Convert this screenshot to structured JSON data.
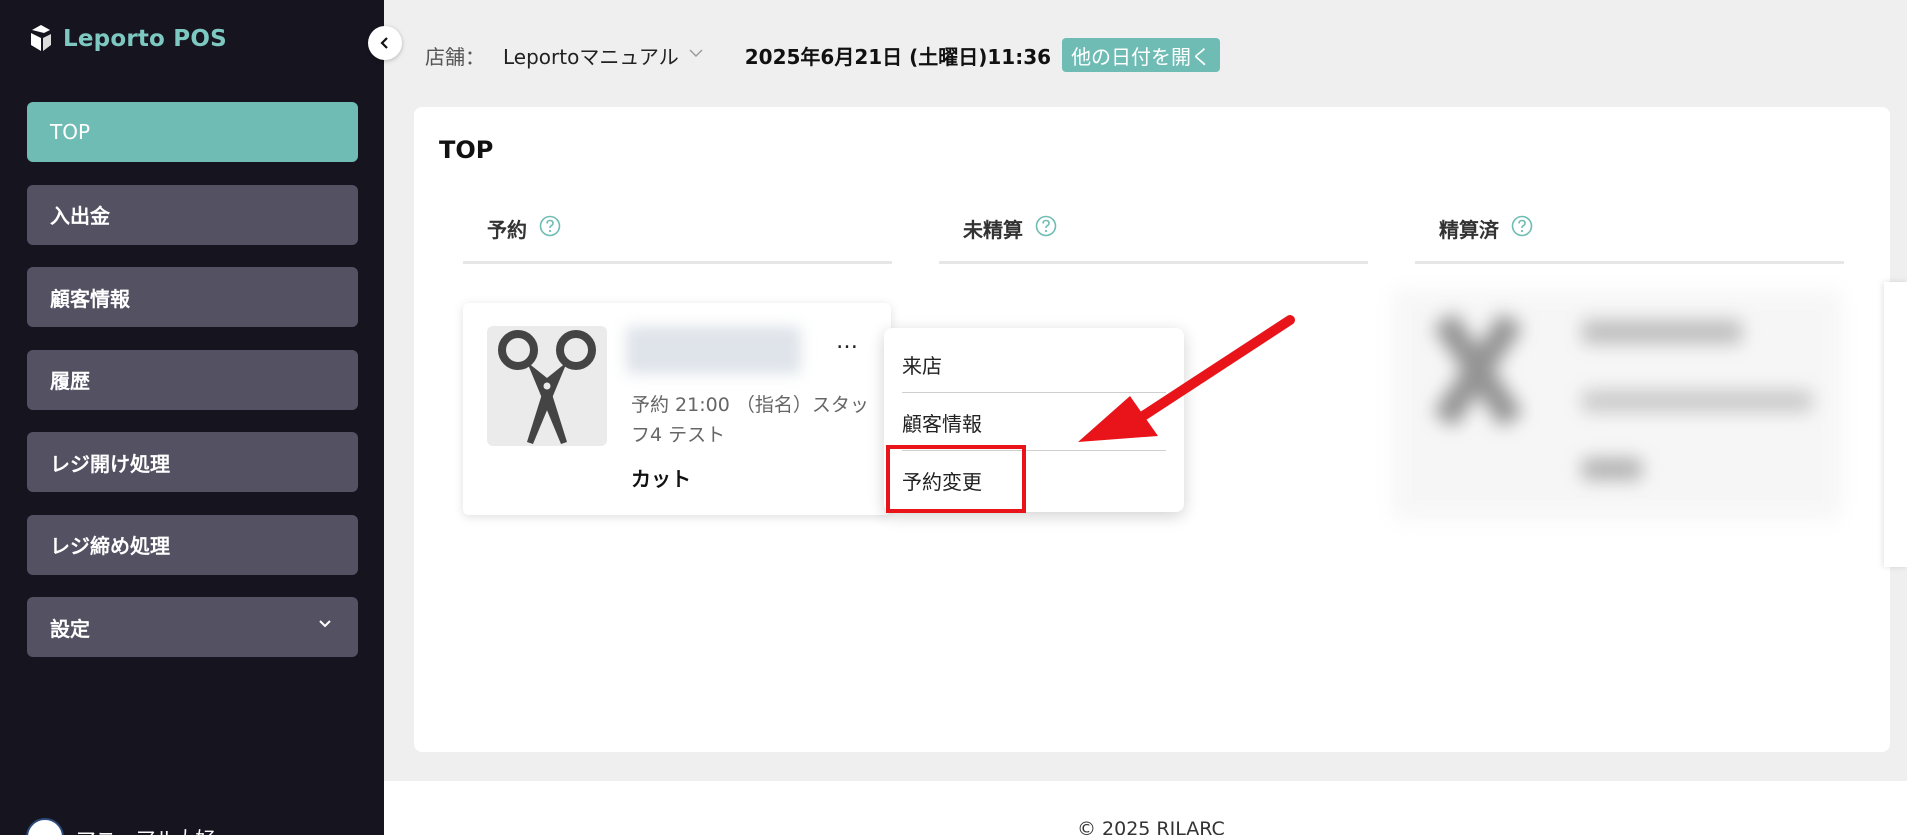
{
  "sidebar": {
    "app_name": "Leporto POS",
    "items": [
      {
        "label": "TOP"
      },
      {
        "label": "入出金"
      },
      {
        "label": "顧客情報"
      },
      {
        "label": "履歴"
      },
      {
        "label": "レジ開け処理"
      },
      {
        "label": "レジ締め処理"
      },
      {
        "label": "設定"
      }
    ],
    "user_name": "マニュアル大好"
  },
  "header": {
    "store_label": "店舗：",
    "store_name": "Leportoマニュアル",
    "datetime": "2025年6月21日 (土曜日)11:36",
    "other_date_button": "他の日付を開く"
  },
  "main": {
    "title": "TOP",
    "columns": [
      {
        "label": "予約"
      },
      {
        "label": "未精算"
      },
      {
        "label": "精算済"
      }
    ],
    "reservation": {
      "info": "予約 21:00 （指名）スタッフ4 テスト",
      "menu": "カット",
      "more_label": "…"
    },
    "dropdown": {
      "items": [
        {
          "label": "来店"
        },
        {
          "label": "顧客情報"
        },
        {
          "label": "予約変更"
        }
      ]
    }
  },
  "footer": {
    "copyright": "© 2025 RILARC"
  },
  "colors": {
    "accent": "#6fbcb5",
    "sidebar_bg": "#16141f",
    "nav_item_bg": "#545163",
    "annotation_red": "#e8141a"
  }
}
